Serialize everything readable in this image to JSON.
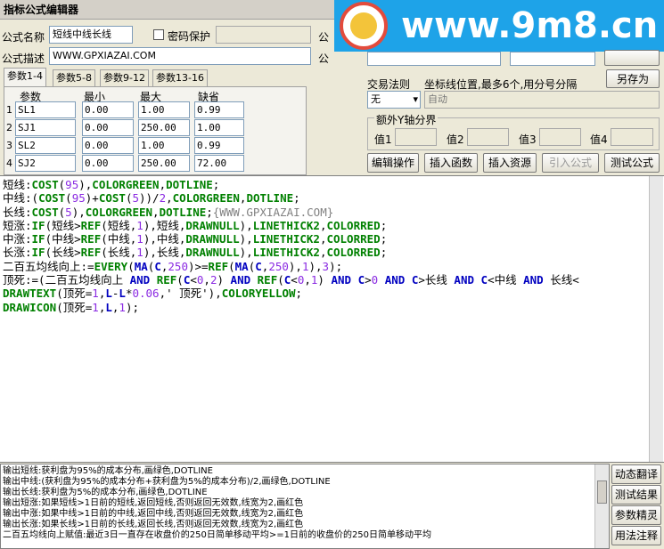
{
  "window": {
    "title": "指标公式编辑器"
  },
  "form": {
    "name_label": "公式名称",
    "name_value": "短线中线长线",
    "password_label": "密码保护",
    "desc_label": "公式描述",
    "desc_value": "WWW.GPXIAZAI.COM",
    "right_label_1": "公",
    "right_label_2": "公"
  },
  "watermark": {
    "text": "www.9m8.cn",
    "logo_text": "九九"
  },
  "tabs": [
    "参数1-4",
    "参数5-8",
    "参数9-12",
    "参数13-16"
  ],
  "params": {
    "headers": [
      "参数",
      "最小",
      "最大",
      "缺省"
    ],
    "rows": [
      {
        "n": "1",
        "name": "SL1",
        "min": "0.00",
        "max": "1.00",
        "def": "0.99"
      },
      {
        "n": "2",
        "name": "SJ1",
        "min": "0.00",
        "max": "250.00",
        "def": "1.00"
      },
      {
        "n": "3",
        "name": "SL2",
        "min": "0.00",
        "max": "1.00",
        "def": "0.99"
      },
      {
        "n": "4",
        "name": "SJ2",
        "min": "0.00",
        "max": "250.00",
        "def": "72.00"
      }
    ]
  },
  "right_panel": {
    "trade_rule_label": "交易法则",
    "trade_rule_value": "无",
    "coord_label": "坐标线位置,最多6个,用分号分隔",
    "coord_value": "自动",
    "save_as": "另存为",
    "yaxis_legend": "额外Y轴分界",
    "value_labels": [
      "值1",
      "值2",
      "值3",
      "值4"
    ]
  },
  "toolbar": [
    "编辑操作",
    "插入函数",
    "插入资源",
    "引入公式",
    "测试公式"
  ],
  "code": [
    [
      [
        "v",
        "短线:"
      ],
      [
        "f",
        "COST"
      ],
      [
        "v",
        "("
      ],
      [
        "n",
        "95"
      ],
      [
        "v",
        "),"
      ],
      [
        "f",
        "COLORGREEN"
      ],
      [
        "v",
        ","
      ],
      [
        "f",
        "DOTLINE"
      ],
      [
        "v",
        ";"
      ]
    ],
    [
      [
        "v",
        "中线:("
      ],
      [
        "f",
        "COST"
      ],
      [
        "v",
        "("
      ],
      [
        "n",
        "95"
      ],
      [
        "v",
        ")+"
      ],
      [
        "f",
        "COST"
      ],
      [
        "v",
        "("
      ],
      [
        "n",
        "5"
      ],
      [
        "v",
        "))/"
      ],
      [
        "n",
        "2"
      ],
      [
        "v",
        ","
      ],
      [
        "f",
        "COLORGREEN"
      ],
      [
        "v",
        ","
      ],
      [
        "f",
        "DOTLINE"
      ],
      [
        "v",
        ";"
      ]
    ],
    [
      [
        "v",
        "长线:"
      ],
      [
        "f",
        "COST"
      ],
      [
        "v",
        "("
      ],
      [
        "n",
        "5"
      ],
      [
        "v",
        "),"
      ],
      [
        "f",
        "COLORGREEN"
      ],
      [
        "v",
        ","
      ],
      [
        "f",
        "DOTLINE"
      ],
      [
        "v",
        ";"
      ],
      [
        "c",
        "{WWW.GPXIAZAI.COM}"
      ]
    ],
    [
      [
        "v",
        "短涨:"
      ],
      [
        "f",
        "IF"
      ],
      [
        "v",
        "(短线>"
      ],
      [
        "f",
        "REF"
      ],
      [
        "v",
        "(短线,"
      ],
      [
        "n",
        "1"
      ],
      [
        "v",
        "),短线,"
      ],
      [
        "f",
        "DRAWNULL"
      ],
      [
        "v",
        "),"
      ],
      [
        "f",
        "LINETHICK2"
      ],
      [
        "v",
        ","
      ],
      [
        "f",
        "COLORRED"
      ],
      [
        "v",
        ";"
      ]
    ],
    [
      [
        "v",
        "中涨:"
      ],
      [
        "f",
        "IF"
      ],
      [
        "v",
        "(中线>"
      ],
      [
        "f",
        "REF"
      ],
      [
        "v",
        "(中线,"
      ],
      [
        "n",
        "1"
      ],
      [
        "v",
        "),中线,"
      ],
      [
        "f",
        "DRAWNULL"
      ],
      [
        "v",
        "),"
      ],
      [
        "f",
        "LINETHICK2"
      ],
      [
        "v",
        ","
      ],
      [
        "f",
        "COLORRED"
      ],
      [
        "v",
        ";"
      ]
    ],
    [
      [
        "v",
        "长涨:"
      ],
      [
        "f",
        "IF"
      ],
      [
        "v",
        "(长线>"
      ],
      [
        "f",
        "REF"
      ],
      [
        "v",
        "(长线,"
      ],
      [
        "n",
        "1"
      ],
      [
        "v",
        "),长线,"
      ],
      [
        "f",
        "DRAWNULL"
      ],
      [
        "v",
        "),"
      ],
      [
        "f",
        "LINETHICK2"
      ],
      [
        "v",
        ","
      ],
      [
        "f",
        "COLORRED"
      ],
      [
        "v",
        ";"
      ]
    ],
    [
      [
        "v",
        "二百五均线向上:="
      ],
      [
        "f",
        "EVERY"
      ],
      [
        "v",
        "("
      ],
      [
        "k",
        "MA"
      ],
      [
        "v",
        "("
      ],
      [
        "k",
        "C"
      ],
      [
        "v",
        ","
      ],
      [
        "n",
        "250"
      ],
      [
        "v",
        ")>="
      ],
      [
        "f",
        "REF"
      ],
      [
        "v",
        "("
      ],
      [
        "k",
        "MA"
      ],
      [
        "v",
        "("
      ],
      [
        "k",
        "C"
      ],
      [
        "v",
        ","
      ],
      [
        "n",
        "250"
      ],
      [
        "v",
        "),"
      ],
      [
        "n",
        "1"
      ],
      [
        "v",
        "),"
      ],
      [
        "n",
        "3"
      ],
      [
        "v",
        ");"
      ]
    ],
    [
      [
        "v",
        "顶死:=(二百五均线向上 "
      ],
      [
        "k",
        "AND"
      ],
      [
        "v",
        " "
      ],
      [
        "f",
        "REF"
      ],
      [
        "v",
        "("
      ],
      [
        "k",
        "C"
      ],
      [
        "v",
        "<"
      ],
      [
        "n",
        "0"
      ],
      [
        "v",
        ","
      ],
      [
        "n",
        "2"
      ],
      [
        "v",
        ") "
      ],
      [
        "k",
        "AND"
      ],
      [
        "v",
        " "
      ],
      [
        "f",
        "REF"
      ],
      [
        "v",
        "("
      ],
      [
        "k",
        "C"
      ],
      [
        "v",
        "<"
      ],
      [
        "n",
        "0"
      ],
      [
        "v",
        ","
      ],
      [
        "n",
        "1"
      ],
      [
        "v",
        ") "
      ],
      [
        "k",
        "AND"
      ],
      [
        "v",
        " "
      ],
      [
        "k",
        "C"
      ],
      [
        "v",
        ">"
      ],
      [
        "n",
        "0"
      ],
      [
        "v",
        " "
      ],
      [
        "k",
        "AND"
      ],
      [
        "v",
        " "
      ],
      [
        "k",
        "C"
      ],
      [
        "v",
        ">长线 "
      ],
      [
        "k",
        "AND"
      ],
      [
        "v",
        " "
      ],
      [
        "k",
        "C"
      ],
      [
        "v",
        "<中线 "
      ],
      [
        "k",
        "AND"
      ],
      [
        "v",
        " 长线<"
      ]
    ],
    [
      [
        "f",
        "DRAWTEXT"
      ],
      [
        "v",
        "(顶死="
      ],
      [
        "n",
        "1"
      ],
      [
        "v",
        ","
      ],
      [
        "k",
        "L"
      ],
      [
        "v",
        "-"
      ],
      [
        "k",
        "L"
      ],
      [
        "v",
        "*"
      ],
      [
        "n",
        "0.06"
      ],
      [
        "v",
        ",' 顶死'),"
      ],
      [
        "f",
        "COLORYELLOW"
      ],
      [
        "v",
        ";"
      ]
    ],
    [
      [
        "f",
        "DRAWICON"
      ],
      [
        "v",
        "(顶死="
      ],
      [
        "n",
        "1"
      ],
      [
        "v",
        ","
      ],
      [
        "k",
        "L"
      ],
      [
        "v",
        ","
      ],
      [
        "n",
        "1"
      ],
      [
        "v",
        ");"
      ]
    ]
  ],
  "output": [
    "输出短线:获利盘为95%的成本分布,画绿色,DOTLINE",
    "输出中线:(获利盘为95%的成本分布+获利盘为5%的成本分布)/2,画绿色,DOTLINE",
    "输出长线:获利盘为5%的成本分布,画绿色,DOTLINE",
    "输出短涨:如果短线>1日前的短线,返回短线,否则返回无效数,线宽为2,画红色",
    "输出中涨:如果中线>1日前的中线,返回中线,否则返回无效数,线宽为2,画红色",
    "输出长涨:如果长线>1日前的长线,返回长线,否则返回无效数,线宽为2,画红色",
    "二百五均线向上赋值:最近3日一直存在收盘价的250日简单移动平均>=1日前的收盘价的250日简单移动平均"
  ],
  "side_buttons": [
    "动态翻译",
    "测试结果",
    "参数精灵",
    "用法注释"
  ]
}
